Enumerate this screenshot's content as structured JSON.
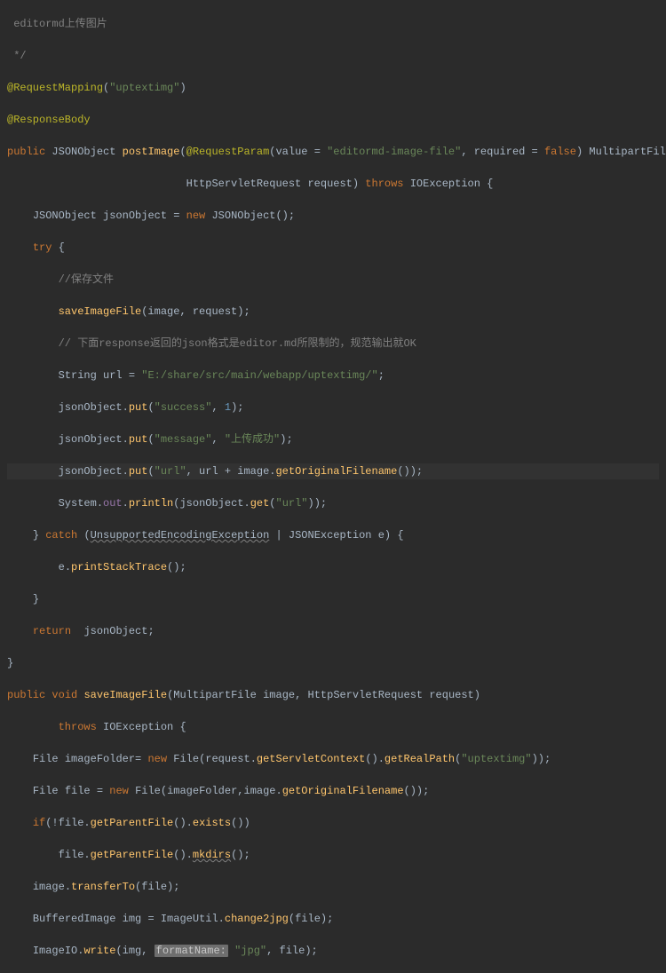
{
  "code": {
    "c00": " editormd上传图片",
    "c01": " */",
    "ann1": "@RequestMapping",
    "s1": "\"uptextimg\"",
    "ann2": "@ResponseBody",
    "kw_public": "public",
    "t_JSONObject": "JSONObject",
    "m_postImage": "postImage",
    "ann3": "@RequestParam",
    "p_value": "value = ",
    "s_value": "\"editormd-image-file\"",
    "p_required": ", required = ",
    "kw_false": "false",
    "t_MultipartFile": "MultipartFile",
    "p_image": "image",
    "t_HttpServletRequest": "HttpServletRequest",
    "p_request": "request",
    "kw_throws": "throws",
    "t_IOException": "IOException",
    "v_jsonObject": "jsonObject",
    "kw_new": "new",
    "kw_try": "try",
    "c_save": "//保存文件",
    "m_saveImageFile": "saveImageFile",
    "c_response": "// 下面response返回的json格式是editor.md所限制的，规范输出就OK",
    "t_String": "String",
    "v_url": "url",
    "s_path": "\"E:/share/src/main/webapp/uptextimg/\"",
    "m_put": "put",
    "s_success": "\"success\"",
    "n_1": "1",
    "s_message": "\"message\"",
    "s_upload_ok": "\"上传成功\"",
    "s_url": "\"url\"",
    "m_getOriginalFilename": "getOriginalFilename",
    "t_System": "System",
    "f_out": "out",
    "m_println": "println",
    "m_get": "get",
    "kw_catch": "catch",
    "t_UnsupportedEncodingException": "UnsupportedEncodingException",
    "t_JSONException": "JSONException",
    "v_e": "e",
    "m_printStackTrace": "printStackTrace",
    "kw_return": "return",
    "kw_void": "void",
    "t_File": "File",
    "v_imageFolder": "imageFolder",
    "m_getServletContext": "getServletContext",
    "m_getRealPath": "getRealPath",
    "s_uptextimg": "\"uptextimg\"",
    "v_file": "file",
    "kw_if": "if",
    "m_getParentFile": "getParentFile",
    "m_exists": "exists",
    "m_mkdirs": "mkdirs",
    "m_transferTo": "transferTo",
    "t_BufferedImage": "BufferedImage",
    "v_img": "img",
    "t_ImageUtil": "ImageUtil",
    "m_change2jpg": "change2jpg",
    "t_ImageIO": "ImageIO",
    "m_write": "write",
    "hint_formatName": "formatName:",
    "s_jpg": "\"jpg\""
  }
}
